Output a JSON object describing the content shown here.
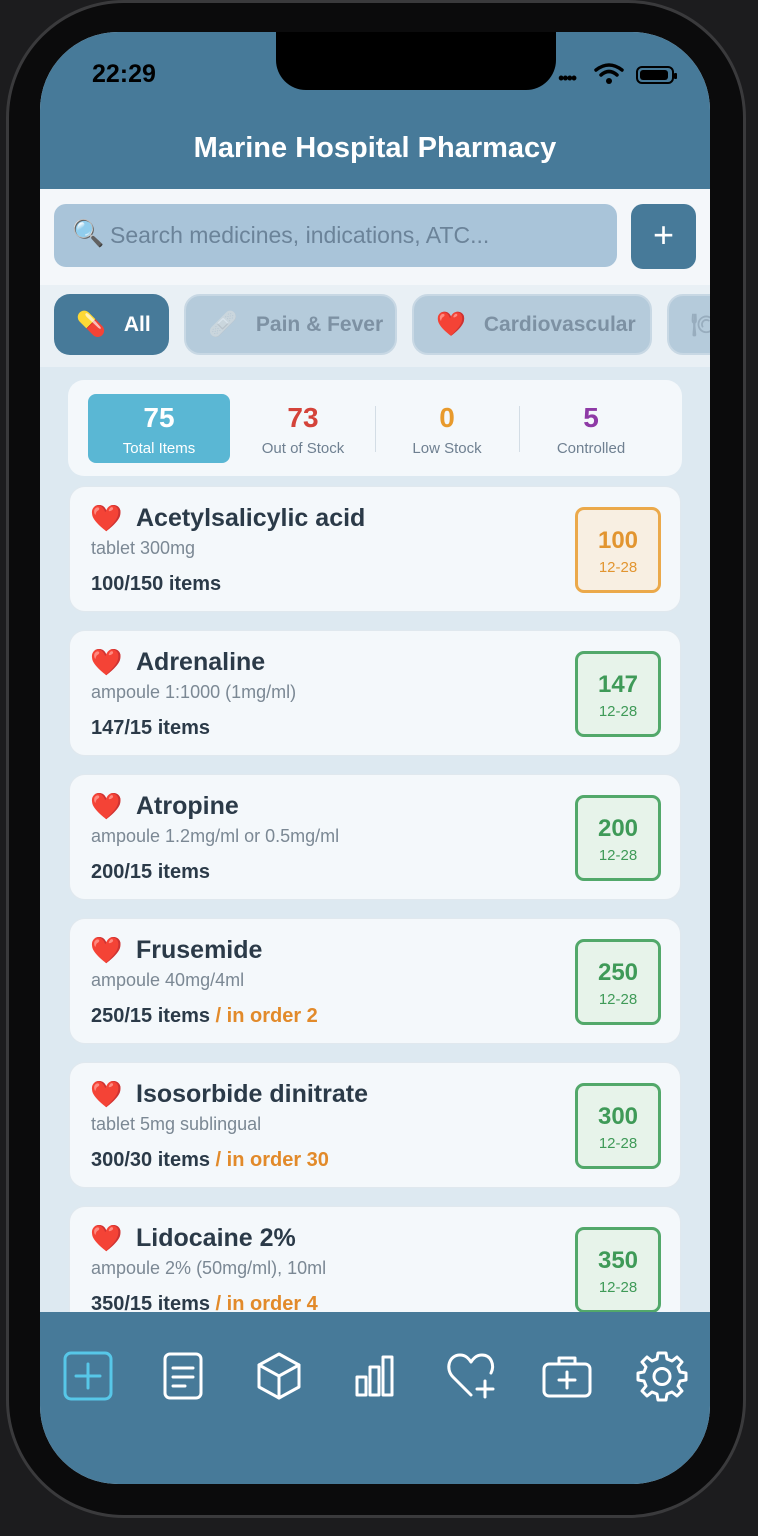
{
  "status": {
    "time": "22:29"
  },
  "header": {
    "title": "Marine Hospital Pharmacy"
  },
  "search": {
    "placeholder": "Search medicines, indications, ATC...",
    "add_label": "+"
  },
  "filters": [
    {
      "label": "All",
      "icon": "pill-icon",
      "active": true
    },
    {
      "label": "Pain & Fever",
      "icon": "bandage-icon",
      "active": false
    },
    {
      "label": "Cardiovascular",
      "icon": "heart-icon",
      "active": false
    }
  ],
  "stats": [
    {
      "value": "75",
      "label": "Total Items",
      "color": "#ffffff"
    },
    {
      "value": "73",
      "label": "Out of Stock",
      "color": "#d4433a"
    },
    {
      "value": "0",
      "label": "Low Stock",
      "color": "#e89a2c"
    },
    {
      "value": "5",
      "label": "Controlled",
      "color": "#8e3aa6"
    }
  ],
  "medicines": [
    {
      "name": "Acetylsalicylic acid",
      "form": "tablet 300mg",
      "qty": "100/150 items",
      "order": "",
      "badge_value": "100",
      "badge_date": "12-28",
      "badge_status": "orange"
    },
    {
      "name": "Adrenaline",
      "form": "ampoule 1:1000 (1mg/ml)",
      "qty": "147/15 items",
      "order": "",
      "badge_value": "147",
      "badge_date": "12-28",
      "badge_status": "green"
    },
    {
      "name": "Atropine",
      "form": "ampoule 1.2mg/ml or 0.5mg/ml",
      "qty": "200/15 items",
      "order": "",
      "badge_value": "200",
      "badge_date": "12-28",
      "badge_status": "green"
    },
    {
      "name": "Frusemide",
      "form": "ampoule 40mg/4ml",
      "qty": "250/15 items",
      "order": " / in order 2",
      "badge_value": "250",
      "badge_date": "12-28",
      "badge_status": "green"
    },
    {
      "name": "Isosorbide dinitrate",
      "form": "tablet 5mg sublingual",
      "qty": "300/30 items",
      "order": " / in order 30",
      "badge_value": "300",
      "badge_date": "12-28",
      "badge_status": "green"
    },
    {
      "name": "Lidocaine 2%",
      "form": "ampoule 2% (50mg/ml), 10ml",
      "qty": "350/15 items",
      "order": " / in order 4",
      "badge_value": "350",
      "badge_date": "12-28",
      "badge_status": "green"
    }
  ],
  "colors": {
    "accent": "#477a99",
    "active_tab": "#57c7e8",
    "heart": "#d11c24"
  },
  "tabs": [
    {
      "icon": "plus-square-icon",
      "active": true
    },
    {
      "icon": "document-icon",
      "active": false
    },
    {
      "icon": "cube-icon",
      "active": false
    },
    {
      "icon": "bar-chart-icon",
      "active": false
    },
    {
      "icon": "heart-plus-icon",
      "active": false
    },
    {
      "icon": "medical-kit-icon",
      "active": false
    },
    {
      "icon": "gear-icon",
      "active": false
    }
  ]
}
